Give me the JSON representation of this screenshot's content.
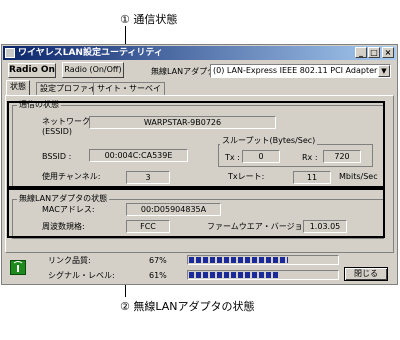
{
  "callouts": {
    "top": "① 通信状態",
    "bottom": "② 無線LANアダプタの状態"
  },
  "window": {
    "title": "ワイヤレスLAN設定ユーティリティ",
    "minimize": "_",
    "maximize": "□",
    "close": "×"
  },
  "toolbar": {
    "radio_on": "Radio On",
    "radio_toggle": "Radio (On/Off)",
    "adapter_label": "無線LANアダプタ",
    "adapter_value": "(0) LAN-Express IEEE 802.11 PCI Adapter",
    "adapter_arrow": "▼"
  },
  "tabs": [
    {
      "label": "状態"
    },
    {
      "label": "設定プロファイル"
    },
    {
      "label": "サイト・サーベイ"
    }
  ],
  "comm_status": {
    "title": "通信の状態",
    "network_name_label": "ネットワーク名:",
    "essid_label": "(ESSID)",
    "network_name_value": "WARPSTAR-9B0726",
    "bssid_label": "BSSID :",
    "bssid_value": "00:004C:CA539E",
    "throughput_title": "スループット(Bytes/Sec)",
    "tx_label": "Tx :",
    "tx_value": "0",
    "rx_label": "Rx :",
    "rx_value": "720",
    "channel_label": "使用チャンネル:",
    "channel_value": "3",
    "txrate_label": "Txレート:",
    "txrate_value": "11",
    "txrate_unit": "Mbits/Sec"
  },
  "adapter_status": {
    "title": "無線LANアダプタの状態",
    "mac_label": "MACアドレス:",
    "mac_value": "00:D05904835A",
    "freq_label": "周波数規格:",
    "freq_value": "FCC",
    "firmware_label": "ファームウエア・バージョン:",
    "firmware_value": "1.03.05"
  },
  "signal": {
    "link_quality_label": "リンク品質:",
    "link_quality_value": "67%",
    "link_quality_level": 0.67,
    "signal_level_label": "シグナル・レベル:",
    "signal_level_value": "61%",
    "signal_level_level": 0.61
  },
  "close_button": "閉じる"
}
